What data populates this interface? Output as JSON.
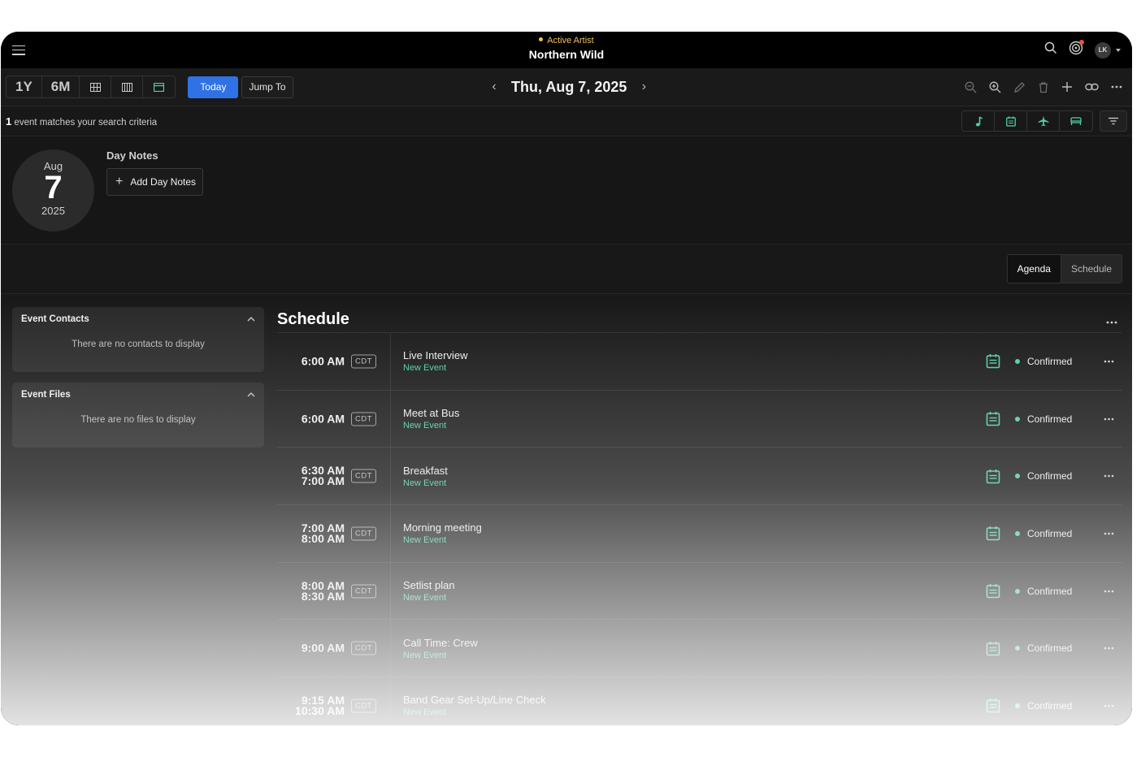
{
  "app": {
    "active_artist_label": "Active Artist",
    "artist_name": "Northern Wild",
    "user_initials": "LK"
  },
  "toolbar": {
    "range_1y": "1Y",
    "range_6m": "6M",
    "today_label": "Today",
    "jump_label": "Jump To",
    "current_date": "Thu, Aug 7, 2025"
  },
  "filter": {
    "match_count": "1",
    "match_text": " event matches your search criteria"
  },
  "day": {
    "month": "Aug",
    "day": "7",
    "year": "2025",
    "notes_title": "Day Notes",
    "add_notes_label": "Add Day Notes"
  },
  "view": {
    "agenda_label": "Agenda",
    "schedule_label": "Schedule"
  },
  "contacts": {
    "title": "Event Contacts",
    "empty_text": "There are no contacts to display"
  },
  "files": {
    "title": "Event Files",
    "empty_text": "There are no files to display"
  },
  "schedule": {
    "title": "Schedule",
    "events": [
      {
        "start": "6:00 AM",
        "end": "",
        "tz": "CDT",
        "title": "Live Interview",
        "subtitle": "New Event",
        "status": "Confirmed"
      },
      {
        "start": "6:00 AM",
        "end": "",
        "tz": "CDT",
        "title": "Meet at Bus",
        "subtitle": "New Event",
        "status": "Confirmed"
      },
      {
        "start": "6:30 AM",
        "end": "7:00 AM",
        "tz": "CDT",
        "title": "Breakfast",
        "subtitle": "New Event",
        "status": "Confirmed"
      },
      {
        "start": "7:00 AM",
        "end": "8:00 AM",
        "tz": "CDT",
        "title": "Morning meeting",
        "subtitle": "New Event",
        "status": "Confirmed"
      },
      {
        "start": "8:00 AM",
        "end": "8:30 AM",
        "tz": "CDT",
        "title": "Setlist plan",
        "subtitle": "New Event",
        "status": "Confirmed"
      },
      {
        "start": "9:00 AM",
        "end": "",
        "tz": "CDT",
        "title": "Call Time: Crew",
        "subtitle": "New Event",
        "status": "Confirmed"
      },
      {
        "start": "9:15 AM",
        "end": "10:30 AM",
        "tz": "CDT",
        "title": "Band Gear Set-Up/Line Check",
        "subtitle": "New Event",
        "status": "Confirmed"
      }
    ]
  },
  "colors": {
    "accent_green": "#4fd1a1",
    "primary_blue": "#2f72e5",
    "active_artist_yellow": "#f1c15a"
  }
}
